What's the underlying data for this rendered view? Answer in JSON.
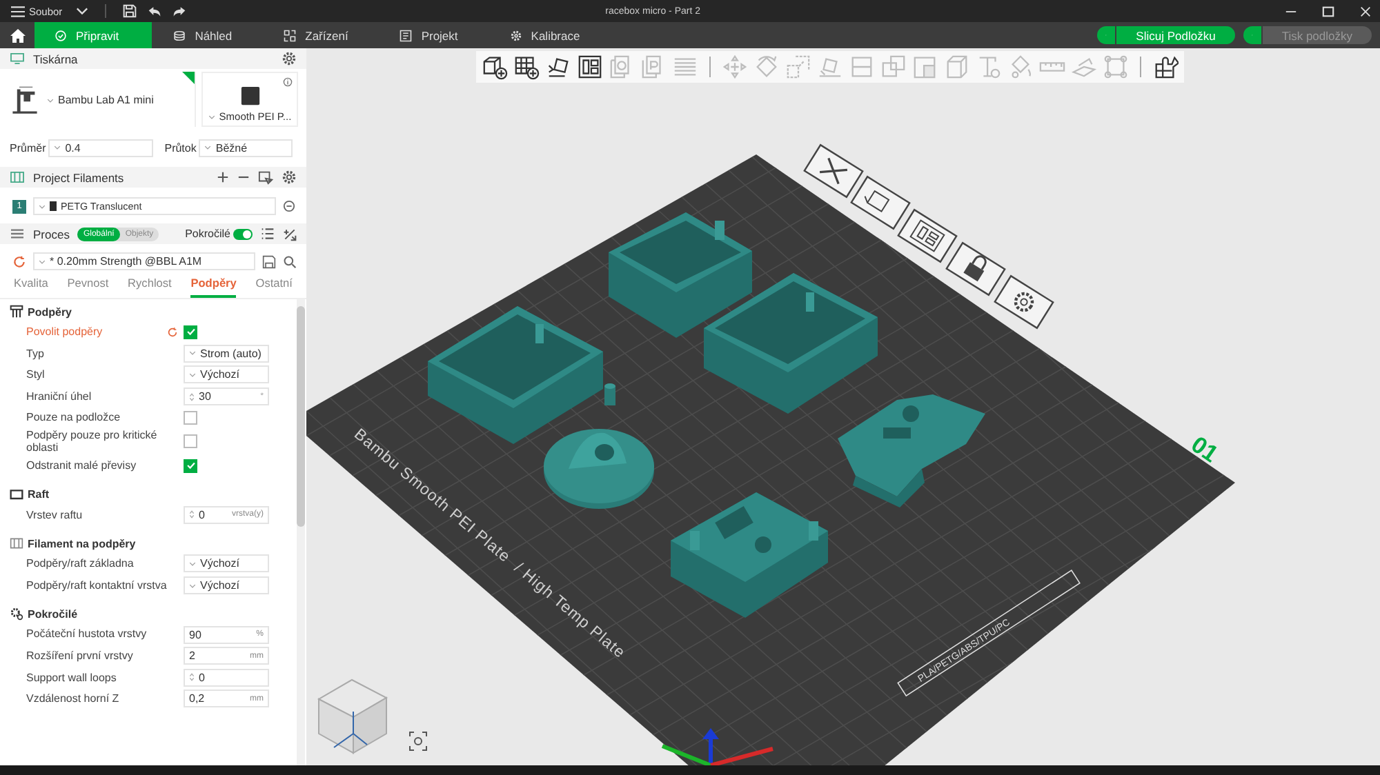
{
  "window": {
    "title": "racebox micro - Part 2",
    "menu": "Soubor"
  },
  "tabs": [
    {
      "label": "Připravit",
      "selected": true,
      "kind": "prepare"
    },
    {
      "label": "Náhled",
      "selected": false,
      "kind": "preview"
    },
    {
      "label": "Zařízení",
      "selected": false,
      "kind": "device"
    },
    {
      "label": "Projekt",
      "selected": false,
      "kind": "project"
    },
    {
      "label": "Kalibrace",
      "selected": false,
      "kind": "calibration"
    }
  ],
  "actions": [
    {
      "label": "Slicuj Podložku",
      "disabled": false
    },
    {
      "label": "Tisk podložky",
      "disabled": true
    }
  ],
  "printer": {
    "title": "Tiskárna",
    "name": "Bambu Lab A1 mini",
    "plate": "Smooth PEI P...",
    "diameter_label": "Průměr",
    "diameter": "0.4",
    "flow_label": "Průtok",
    "flow": "Běžné"
  },
  "filaments": {
    "title": "Project Filaments",
    "items": [
      {
        "index": "1",
        "name": "PETG Translucent",
        "color": "#2b2b2b"
      }
    ]
  },
  "process": {
    "title": "Proces",
    "scope": [
      {
        "label": "Globální",
        "selected": true
      },
      {
        "label": "Objekty",
        "selected": false
      }
    ],
    "advanced_label": "Pokročilé",
    "advanced": true,
    "preset": "* 0.20mm Strength @BBL A1M"
  },
  "setting_tabs": [
    {
      "label": "Kvalita",
      "selected": false
    },
    {
      "label": "Pevnost",
      "selected": false
    },
    {
      "label": "Rychlost",
      "selected": false
    },
    {
      "label": "Podpěry",
      "selected": true
    },
    {
      "label": "Ostatní",
      "selected": false
    }
  ],
  "sections": [
    {
      "title": "Podpěry",
      "kind": "support",
      "rows": [
        {
          "label": "Povolit podpěry",
          "kind": "checkbox",
          "checked": true,
          "modified": true
        },
        {
          "label": "Typ",
          "kind": "select",
          "value": "Strom (auto)",
          "modified": false
        },
        {
          "label": "Styl",
          "kind": "select",
          "value": "Výchozí",
          "modified": false
        },
        {
          "label": "Hraniční úhel",
          "kind": "spin",
          "value": "30",
          "unit": "°",
          "modified": false
        },
        {
          "label": "Pouze na podložce",
          "kind": "checkbox",
          "checked": false,
          "modified": false
        },
        {
          "label": "Podpěry pouze pro kritické oblasti",
          "kind": "checkbox",
          "checked": false,
          "modified": false
        },
        {
          "label": "Odstranit malé převisy",
          "kind": "checkbox",
          "checked": true,
          "modified": false
        }
      ]
    },
    {
      "title": "Raft",
      "kind": "raft",
      "rows": [
        {
          "label": "Vrstev raftu",
          "kind": "spin",
          "value": "0",
          "unit": "vrstva(y)",
          "modified": false
        }
      ]
    },
    {
      "title": "Filament na podpěry",
      "kind": "filament",
      "rows": [
        {
          "label": "Podpěry/raft základna",
          "kind": "select",
          "value": "Výchozí",
          "modified": false
        },
        {
          "label": "Podpěry/raft kontaktní vrstva",
          "kind": "select",
          "value": "Výchozí",
          "modified": false
        }
      ]
    },
    {
      "title": "Pokročilé",
      "kind": "advanced",
      "rows": [
        {
          "label": "Počáteční hustota vrstvy",
          "kind": "number",
          "value": "90",
          "unit": "%",
          "modified": false
        },
        {
          "label": "Rozšíření první vrstvy",
          "kind": "number",
          "value": "2",
          "unit": "mm",
          "modified": false
        },
        {
          "label": "Support wall loops",
          "kind": "spin",
          "value": "0",
          "modified": false
        },
        {
          "label": "Vzdálenost horní Z",
          "kind": "number",
          "value": "0,2",
          "unit": "mm",
          "modified": false
        }
      ]
    }
  ],
  "toolbar": [
    {
      "kind": "cube-plus",
      "disabled": false
    },
    {
      "kind": "grid-plus",
      "disabled": false
    },
    {
      "kind": "orient",
      "disabled": false
    },
    {
      "kind": "arrange",
      "disabled": false
    },
    {
      "kind": "copy",
      "disabled": true
    },
    {
      "kind": "paste",
      "disabled": true
    },
    {
      "kind": "layers",
      "disabled": true
    },
    {
      "kind": "separator"
    },
    {
      "kind": "move",
      "disabled": true
    },
    {
      "kind": "rotate",
      "disabled": true
    },
    {
      "kind": "scale",
      "disabled": true
    },
    {
      "kind": "lay-flat",
      "disabled": true
    },
    {
      "kind": "cut",
      "disabled": true
    },
    {
      "kind": "boolean",
      "disabled": true
    },
    {
      "kind": "split",
      "disabled": true
    },
    {
      "kind": "box",
      "disabled": true
    },
    {
      "kind": "text",
      "disabled": true
    },
    {
      "kind": "paint",
      "disabled": true
    },
    {
      "kind": "ruler",
      "disabled": true
    },
    {
      "kind": "emboss",
      "disabled": true
    },
    {
      "kind": "bounds",
      "disabled": true
    },
    {
      "kind": "separator"
    },
    {
      "kind": "puzzle",
      "disabled": false
    }
  ],
  "viewport": {
    "plate_name": "Bambu Smooth PEI Plate",
    "plate_type": "/ High Temp Plate",
    "materials": "PLA/PETG/ABS/TPU/PC",
    "plate_number": "01"
  }
}
